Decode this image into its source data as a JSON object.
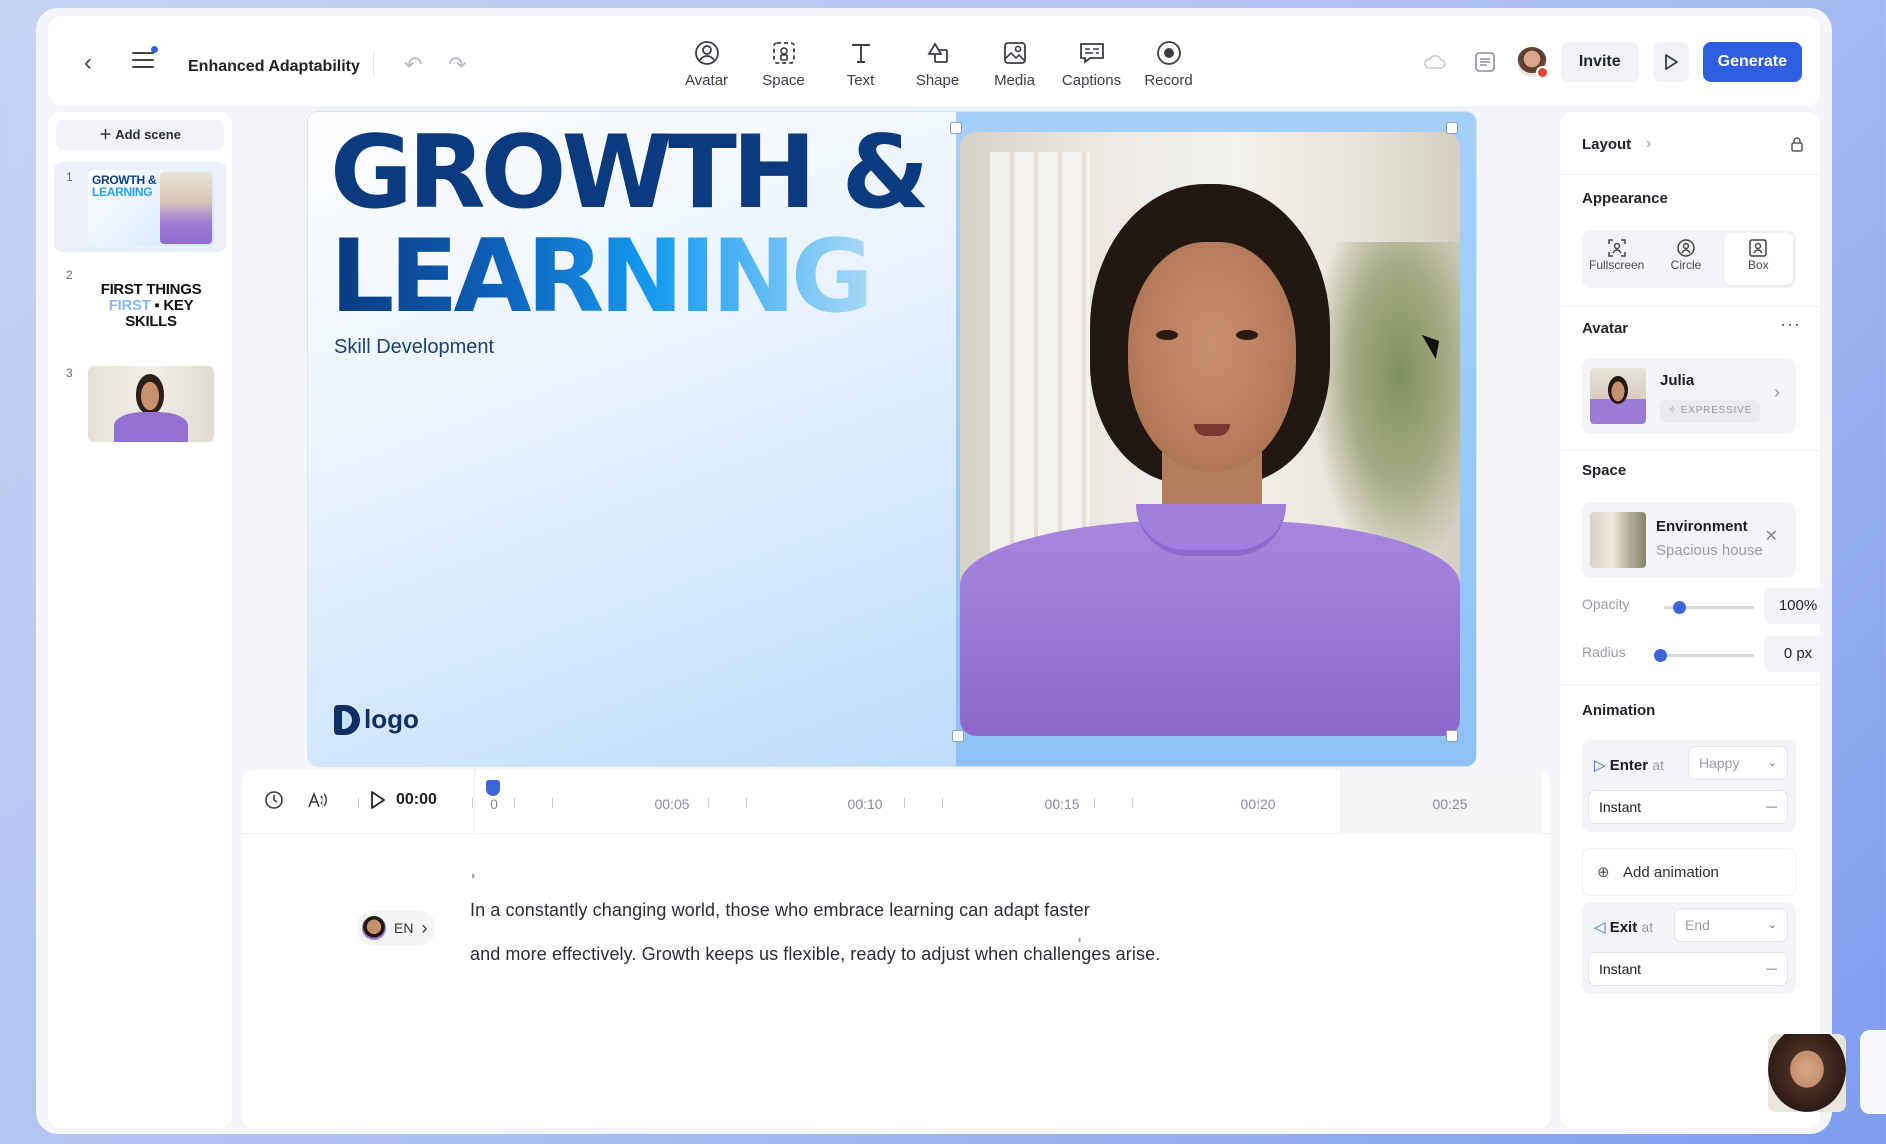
{
  "header": {
    "title": "Enhanced Adaptability",
    "tools": [
      {
        "label": "Avatar",
        "icon": "avatar-icon"
      },
      {
        "label": "Space",
        "icon": "space-icon"
      },
      {
        "label": "Text",
        "icon": "text-icon"
      },
      {
        "label": "Shape",
        "icon": "shape-icon"
      },
      {
        "label": "Media",
        "icon": "media-icon"
      },
      {
        "label": "Captions",
        "icon": "captions-icon"
      },
      {
        "label": "Record",
        "icon": "record-icon"
      }
    ],
    "invite_label": "Invite",
    "generate_label": "Generate"
  },
  "scenes": {
    "add_label": "Add scene",
    "items": [
      {
        "number": "1",
        "title_a": "GROWTH &",
        "title_b": "LEARNING"
      },
      {
        "number": "2",
        "line1": "FIRST THINGS",
        "line2_a": "FIRST",
        "line2_b": "KEY",
        "line3": "SKILLS"
      },
      {
        "number": "3"
      }
    ]
  },
  "canvas": {
    "title_line1": "GROWTH &",
    "title_line2": "LEARNING",
    "subtitle": "Skill Development",
    "logo_text": "logo"
  },
  "timeline": {
    "current_time": "00:00",
    "ruler_labels": [
      "0",
      "00:05",
      "00:10",
      "00:15",
      "00:20",
      "00:25"
    ]
  },
  "script": {
    "language": "EN",
    "line1": "In a constantly changing world, those who embrace learning can adapt faster",
    "line2": "and more effectively. Growth keeps us flexible, ready to adjust when challenges arise."
  },
  "panel": {
    "layout_label": "Layout",
    "appearance": {
      "heading": "Appearance",
      "options": [
        {
          "label": "Fullscreen"
        },
        {
          "label": "Circle"
        },
        {
          "label": "Box",
          "selected": true
        }
      ]
    },
    "avatar": {
      "heading": "Avatar",
      "name": "Julia",
      "badge": "EXPRESSIVE"
    },
    "space": {
      "heading": "Space",
      "name": "Environment",
      "detail": "Spacious house",
      "opacity_label": "Opacity",
      "opacity_value": "100%",
      "opacity_fraction": 0.1,
      "radius_label": "Radius",
      "radius_value": "0 px",
      "radius_fraction": 0.0
    },
    "animation": {
      "heading": "Animation",
      "enter_label": "Enter",
      "enter_at": "at",
      "enter_value": "Happy",
      "enter_mode": "Instant",
      "add_label": "Add animation",
      "exit_label": "Exit",
      "exit_at": "at",
      "exit_value": "End",
      "exit_mode": "Instant"
    }
  },
  "colors": {
    "accent": "#2f5fe0",
    "title_dark": "#0b3a7e",
    "sweater": "#9774d4"
  }
}
